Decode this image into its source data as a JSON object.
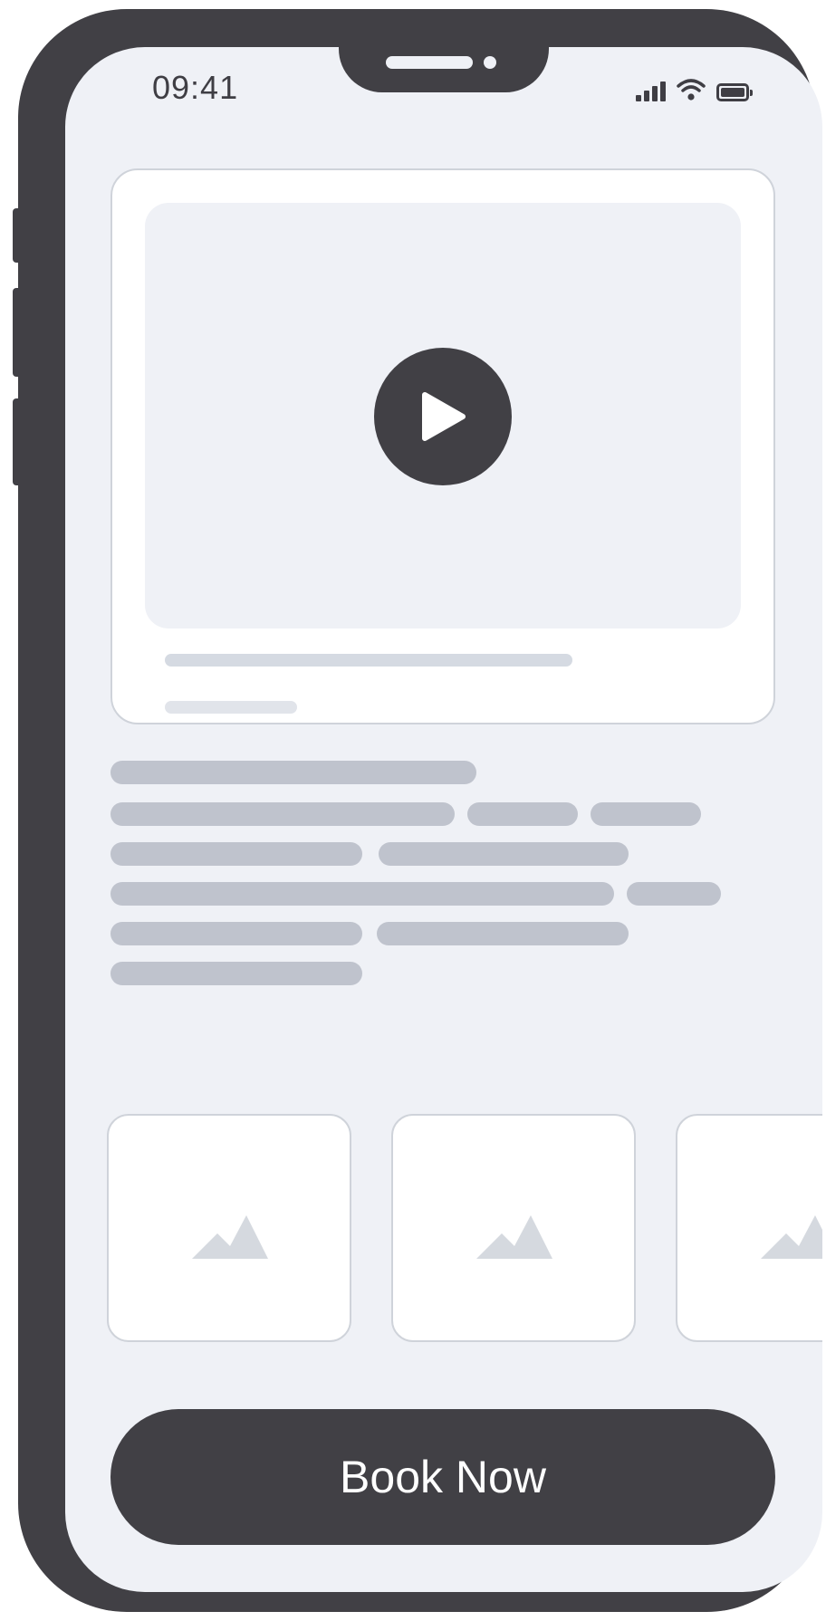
{
  "status_bar": {
    "time": "09:41",
    "icons": [
      "cellular-signal-icon",
      "wifi-icon",
      "battery-icon"
    ]
  },
  "video_card": {
    "play_icon": "play-icon"
  },
  "gallery": {
    "thumbnails": [
      {
        "icon": "image-placeholder-icon"
      },
      {
        "icon": "image-placeholder-icon"
      },
      {
        "icon": "image-placeholder-icon"
      }
    ]
  },
  "cta": {
    "label": "Book Now"
  },
  "colors": {
    "frame": "#414045",
    "screen_bg": "#eff1f6",
    "card_bg": "#ffffff",
    "placeholder_text": "#bfc3cd",
    "placeholder_light": "#d5dae2",
    "icon_placeholder": "#d5d9df",
    "cta_bg": "#414045",
    "cta_text": "#ffffff"
  }
}
